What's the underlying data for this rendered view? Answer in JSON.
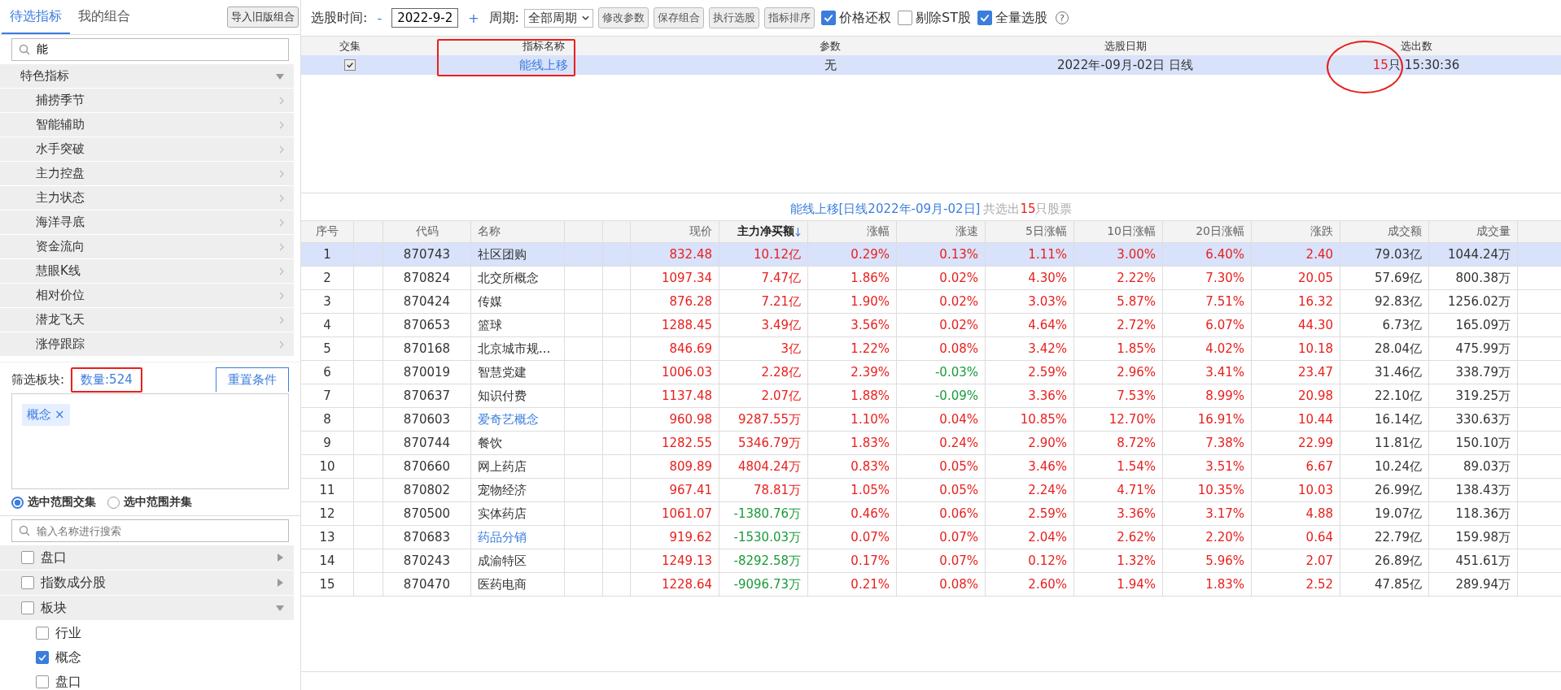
{
  "left_tabs": [
    {
      "label": "待选指标",
      "selected": true
    },
    {
      "label": "我的组合",
      "selected": false
    }
  ],
  "import_button": "导入旧版组合",
  "indicator_search": {
    "value": "能"
  },
  "indicator_tree": [
    {
      "label": "特色指标",
      "expanded": true,
      "children": [
        {
          "label": "捕捞季节"
        },
        {
          "label": "智能辅助"
        },
        {
          "label": "水手突破"
        },
        {
          "label": "主力控盘"
        },
        {
          "label": "主力状态"
        },
        {
          "label": "海洋寻底"
        },
        {
          "label": "资金流向"
        },
        {
          "label": "慧眼K线"
        },
        {
          "label": "相对价位"
        },
        {
          "label": "潜龙飞天"
        },
        {
          "label": "涨停跟踪"
        }
      ]
    }
  ],
  "filter": {
    "label": "筛选板块:",
    "count": "数量:524",
    "count_boxed": true,
    "reset_button": "重置条件",
    "tags": [
      {
        "label": "概念",
        "remove": "×"
      }
    ]
  },
  "range_options": [
    {
      "label": "选中范围交集",
      "selected": true
    },
    {
      "label": "选中范围并集",
      "selected": false
    }
  ],
  "sector_search": {
    "placeholder": "输入名称进行搜索"
  },
  "sector_tree": [
    {
      "label": "盘口",
      "checked": false,
      "expanded": false
    },
    {
      "label": "指数成分股",
      "checked": false,
      "expanded": false
    },
    {
      "label": "板块",
      "checked": false,
      "expanded": true,
      "children": [
        {
          "label": "行业",
          "checked": false
        },
        {
          "label": "概念",
          "checked": true
        },
        {
          "label": "盘口",
          "checked": false
        }
      ]
    }
  ],
  "toolbar": {
    "time_label": "选股时间:",
    "minus": "-",
    "date": "2022-9-2",
    "plus": "+",
    "period_label": "周期:",
    "period": "全部周期",
    "buttons": [
      "修改参数",
      "保存组合",
      "执行选股",
      "指标排序"
    ],
    "checks": [
      {
        "label": "价格还权",
        "checked": true
      },
      {
        "label": "剔除ST股",
        "checked": false
      },
      {
        "label": "全量选股",
        "checked": true
      }
    ],
    "help": "?"
  },
  "indicator_table": {
    "columns": [
      {
        "label": "交集",
        "boxed": false,
        "circled": false
      },
      {
        "label": "指标名称",
        "boxed": true,
        "circled": false
      },
      {
        "label": "参数",
        "boxed": false,
        "circled": false
      },
      {
        "label": "选股日期",
        "boxed": false,
        "circled": false
      },
      {
        "label": "选出数",
        "boxed": false,
        "circled": true
      }
    ],
    "rows": [
      {
        "selected": true,
        "checked": true,
        "name": "能线上移",
        "params": "无",
        "date": "2022年-09月-02日 日线",
        "count": "15",
        "unit": "只",
        "time": "15:30:36"
      }
    ]
  },
  "result_caption": {
    "title": "能线上移[日线2022年-09月-02日]",
    "prefix": "共选出",
    "count": "15",
    "suffix": "只股票"
  },
  "result_table": {
    "columns": [
      {
        "label": "序号",
        "sorted": false
      },
      {
        "label": "代码",
        "sorted": false
      },
      {
        "label": "名称",
        "sorted": false
      },
      {
        "label": "现价",
        "sorted": false
      },
      {
        "label": "主力净买额",
        "sorted": true
      },
      {
        "label": "涨幅",
        "sorted": false
      },
      {
        "label": "涨速",
        "sorted": false
      },
      {
        "label": "5日涨幅",
        "sorted": false
      },
      {
        "label": "10日涨幅",
        "sorted": false
      },
      {
        "label": "20日涨幅",
        "sorted": false
      },
      {
        "label": "涨跌",
        "sorted": false
      },
      {
        "label": "成交额",
        "sorted": false
      },
      {
        "label": "成交量",
        "sorted": false
      }
    ],
    "rows": [
      {
        "selected": true,
        "linked": false,
        "net_buy_down": false,
        "speed_down": false,
        "cells": [
          "1",
          "870743",
          "社区团购",
          "832.48",
          "10.12亿",
          "0.29%",
          "0.13%",
          "1.11%",
          "3.00%",
          "6.40%",
          "2.40",
          "79.03亿",
          "1044.24万"
        ]
      },
      {
        "selected": false,
        "linked": false,
        "net_buy_down": false,
        "speed_down": false,
        "cells": [
          "2",
          "870824",
          "北交所概念",
          "1097.34",
          "7.47亿",
          "1.86%",
          "0.02%",
          "4.30%",
          "2.22%",
          "7.30%",
          "20.05",
          "57.69亿",
          "800.38万"
        ]
      },
      {
        "selected": false,
        "linked": false,
        "net_buy_down": false,
        "speed_down": false,
        "cells": [
          "3",
          "870424",
          "传媒",
          "876.28",
          "7.21亿",
          "1.90%",
          "0.02%",
          "3.03%",
          "5.87%",
          "7.51%",
          "16.32",
          "92.83亿",
          "1256.02万"
        ]
      },
      {
        "selected": false,
        "linked": false,
        "net_buy_down": false,
        "speed_down": false,
        "cells": [
          "4",
          "870653",
          "篮球",
          "1288.45",
          "3.49亿",
          "3.56%",
          "0.02%",
          "4.64%",
          "2.72%",
          "6.07%",
          "44.30",
          "6.73亿",
          "165.09万"
        ]
      },
      {
        "selected": false,
        "linked": false,
        "net_buy_down": false,
        "speed_down": false,
        "cells": [
          "5",
          "870168",
          "北京城市规...",
          "846.69",
          "3亿",
          "1.22%",
          "0.08%",
          "3.42%",
          "1.85%",
          "4.02%",
          "10.18",
          "28.04亿",
          "475.99万"
        ]
      },
      {
        "selected": false,
        "linked": false,
        "net_buy_down": false,
        "speed_down": true,
        "cells": [
          "6",
          "870019",
          "智慧党建",
          "1006.03",
          "2.28亿",
          "2.39%",
          "-0.03%",
          "2.59%",
          "2.96%",
          "3.41%",
          "23.47",
          "31.46亿",
          "338.79万"
        ]
      },
      {
        "selected": false,
        "linked": false,
        "net_buy_down": false,
        "speed_down": true,
        "cells": [
          "7",
          "870637",
          "知识付费",
          "1137.48",
          "2.07亿",
          "1.88%",
          "-0.09%",
          "3.36%",
          "7.53%",
          "8.99%",
          "20.98",
          "22.10亿",
          "319.25万"
        ]
      },
      {
        "selected": false,
        "linked": true,
        "net_buy_down": false,
        "speed_down": false,
        "cells": [
          "8",
          "870603",
          "爱奇艺概念",
          "960.98",
          "9287.55万",
          "1.10%",
          "0.04%",
          "10.85%",
          "12.70%",
          "16.91%",
          "10.44",
          "16.14亿",
          "330.63万"
        ]
      },
      {
        "selected": false,
        "linked": false,
        "net_buy_down": false,
        "speed_down": false,
        "cells": [
          "9",
          "870744",
          "餐饮",
          "1282.55",
          "5346.79万",
          "1.83%",
          "0.24%",
          "2.90%",
          "8.72%",
          "7.38%",
          "22.99",
          "11.81亿",
          "150.10万"
        ]
      },
      {
        "selected": false,
        "linked": false,
        "net_buy_down": false,
        "speed_down": false,
        "cells": [
          "10",
          "870660",
          "网上药店",
          "809.89",
          "4804.24万",
          "0.83%",
          "0.05%",
          "3.46%",
          "1.54%",
          "3.51%",
          "6.67",
          "10.24亿",
          "89.03万"
        ]
      },
      {
        "selected": false,
        "linked": false,
        "net_buy_down": false,
        "speed_down": false,
        "cells": [
          "11",
          "870802",
          "宠物经济",
          "967.41",
          "78.81万",
          "1.05%",
          "0.05%",
          "2.24%",
          "4.71%",
          "10.35%",
          "10.03",
          "26.99亿",
          "138.43万"
        ]
      },
      {
        "selected": false,
        "linked": false,
        "net_buy_down": true,
        "speed_down": false,
        "cells": [
          "12",
          "870500",
          "实体药店",
          "1061.07",
          "-1380.76万",
          "0.46%",
          "0.06%",
          "2.59%",
          "3.36%",
          "3.17%",
          "4.88",
          "19.07亿",
          "118.36万"
        ]
      },
      {
        "selected": false,
        "linked": true,
        "net_buy_down": true,
        "speed_down": false,
        "cells": [
          "13",
          "870683",
          "药品分销",
          "919.62",
          "-1530.03万",
          "0.07%",
          "0.07%",
          "2.04%",
          "2.62%",
          "2.20%",
          "0.64",
          "22.79亿",
          "159.98万"
        ]
      },
      {
        "selected": false,
        "linked": false,
        "net_buy_down": true,
        "speed_down": false,
        "cells": [
          "14",
          "870243",
          "成渝特区",
          "1249.13",
          "-8292.58万",
          "0.17%",
          "0.07%",
          "0.12%",
          "1.32%",
          "5.96%",
          "2.07",
          "26.89亿",
          "451.61万"
        ]
      },
      {
        "selected": false,
        "linked": false,
        "net_buy_down": true,
        "speed_down": false,
        "cells": [
          "15",
          "870470",
          "医药电商",
          "1228.64",
          "-9096.73万",
          "0.21%",
          "0.08%",
          "2.60%",
          "1.94%",
          "1.83%",
          "2.52",
          "47.85亿",
          "289.94万"
        ]
      }
    ]
  }
}
